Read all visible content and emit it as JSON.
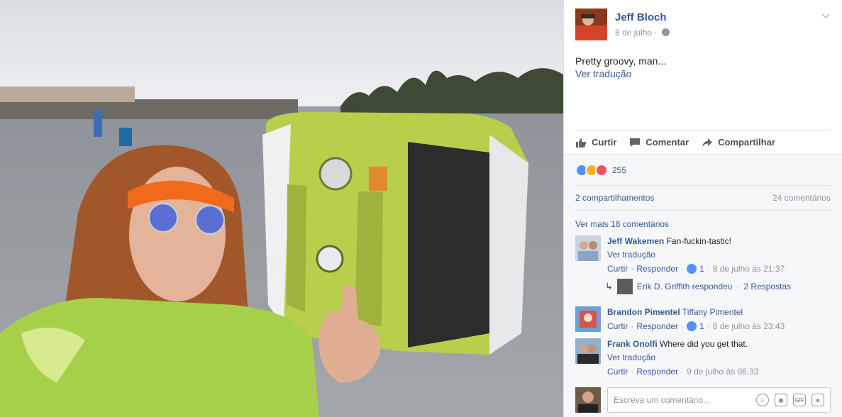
{
  "post": {
    "author": "Jeff Bloch",
    "date": "8 de julho",
    "privacy_icon": "globe-icon",
    "text": "Pretty groovy, man...",
    "see_translation": "Ver tradução"
  },
  "actions": {
    "like": "Curtir",
    "comment": "Comentar",
    "share": "Compartilhar"
  },
  "reactions": {
    "types": [
      "like",
      "haha",
      "love"
    ],
    "count": "255"
  },
  "stats": {
    "shares": "2 compartilhamentos",
    "comments": "24 comentários"
  },
  "more_comments": "Ver mais 18 comentários",
  "comments": [
    {
      "author": "Jeff Wakemen",
      "text": "Fan-fuckin-tastic!",
      "translation": "Ver tradução",
      "like": "Curtir",
      "reply": "Responder",
      "likes": "1",
      "time": "8 de julho às 21:37"
    },
    {
      "author": "Brandon Pimentel",
      "text": "Tiffany Pimentel",
      "like": "Curtir",
      "reply": "Responder",
      "likes": "1",
      "time": "8 de julho às 23:43"
    },
    {
      "author": "Frank Onolfi",
      "text": "Where did you get that.",
      "translation": "Ver tradução",
      "like": "Curtir",
      "reply": "Responder",
      "time": "9 de julho às 06:33"
    }
  ],
  "reply_summary": {
    "name": "Erik D. Griffith respondeu",
    "text": "2 Respostas"
  },
  "compose": {
    "placeholder": "Escreva um comentário..."
  },
  "colors": {
    "link": "#365899",
    "muted": "#90949c",
    "like_blue": "#5890ff"
  }
}
